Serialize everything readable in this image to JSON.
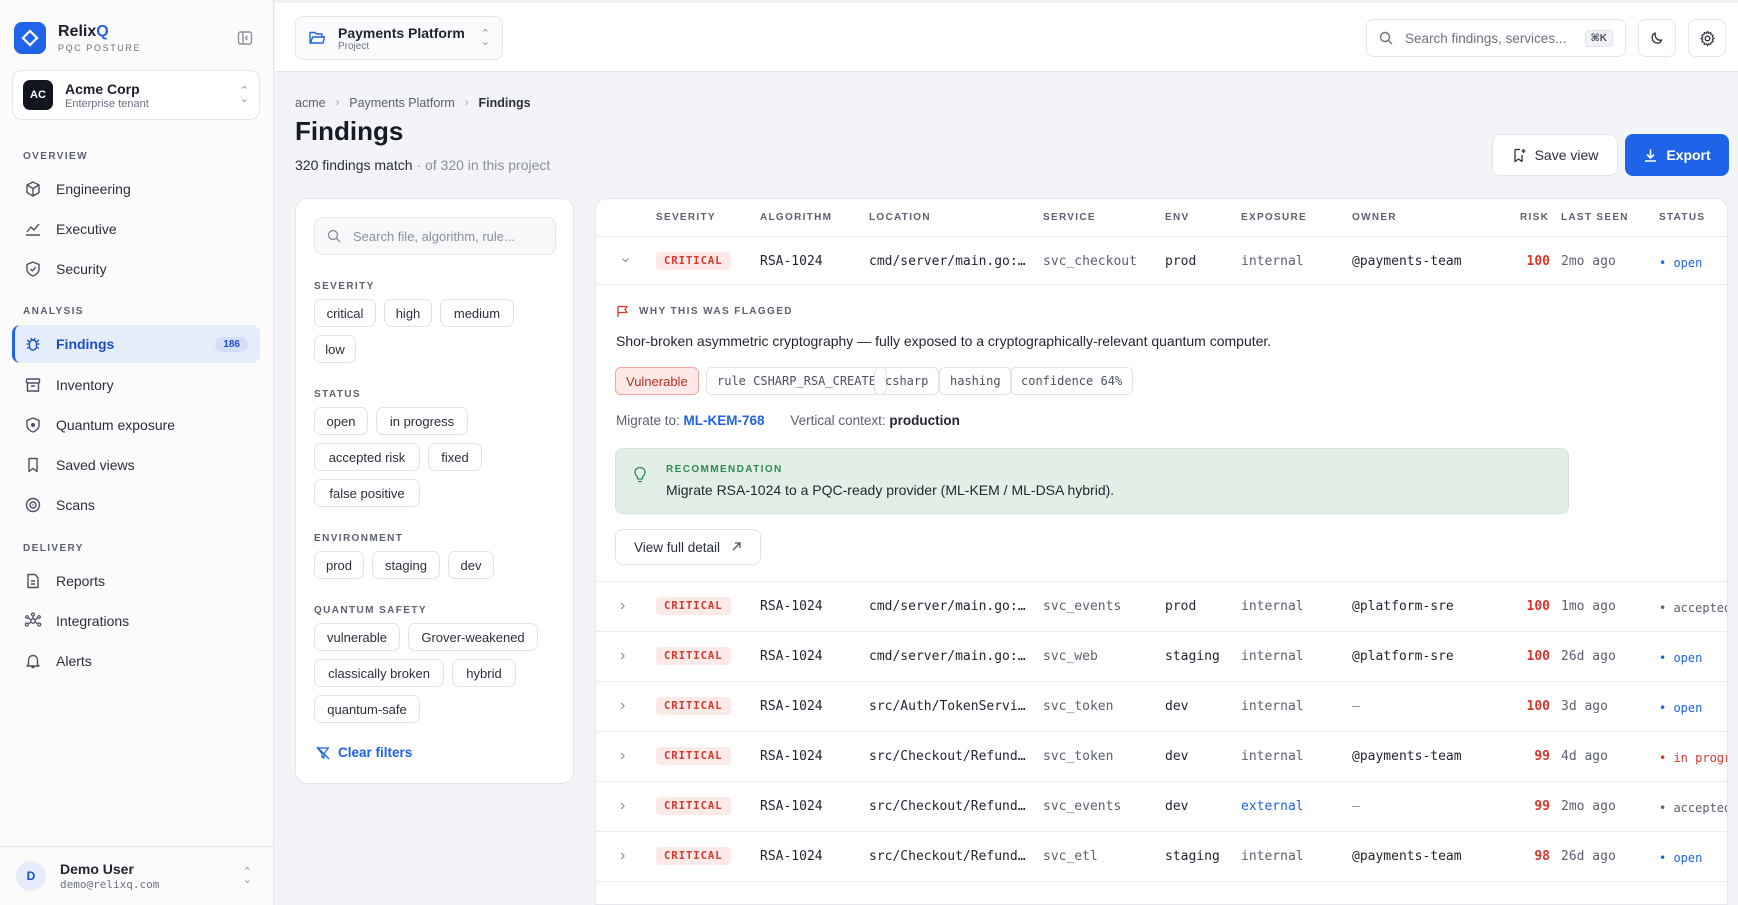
{
  "brand": {
    "name": "Relix",
    "name_q": "Q",
    "sub": "PQC POSTURE"
  },
  "tenant": {
    "initials": "AC",
    "name": "Acme Corp",
    "sub": "Enterprise tenant"
  },
  "nav": {
    "overview_label": "OVERVIEW",
    "analysis_label": "ANALYSIS",
    "delivery_label": "DELIVERY",
    "overview": [
      "Engineering",
      "Executive",
      "Security"
    ],
    "analysis": [
      "Findings",
      "Inventory",
      "Quantum exposure",
      "Saved views",
      "Scans"
    ],
    "findings_badge": "186",
    "delivery": [
      "Reports",
      "Integrations",
      "Alerts"
    ]
  },
  "user": {
    "initial": "D",
    "name": "Demo User",
    "email": "demo@relixq.com"
  },
  "topbar": {
    "project_name": "Payments Platform",
    "project_sub": "Project",
    "search_placeholder": "Search findings, services...",
    "search_kbd": "⌘K"
  },
  "page": {
    "breadcrumb": [
      "acme",
      "Payments Platform",
      "Findings"
    ],
    "title": "Findings",
    "count": "320 findings match",
    "count_sub": " · of 320 in this project",
    "save_view": "Save view",
    "export": "Export"
  },
  "filters": {
    "search_placeholder": "Search file, algorithm, rule...",
    "severity_label": "SEVERITY",
    "severity": [
      "critical",
      "high",
      "medium",
      "low"
    ],
    "status_label": "STATUS",
    "status": [
      "open",
      "in progress",
      "accepted risk",
      "fixed",
      "false positive"
    ],
    "environment_label": "ENVIRONMENT",
    "environment": [
      "prod",
      "staging",
      "dev"
    ],
    "quantum_label": "QUANTUM SAFETY",
    "quantum": [
      "vulnerable",
      "Grover-weakened",
      "classically broken",
      "hybrid",
      "quantum-safe"
    ],
    "clear": "Clear filters"
  },
  "table": {
    "headers": [
      "SEVERITY",
      "ALGORITHM",
      "LOCATION",
      "SERVICE",
      "ENV",
      "EXPOSURE",
      "OWNER",
      "RISK",
      "LAST SEEN",
      "STATUS"
    ],
    "rows": [
      {
        "sev": "CRITICAL",
        "algo": "RSA-1024",
        "loc": "cmd/server/main.go:…",
        "svc": "svc_checkout",
        "env": "prod",
        "exp": "internal",
        "owner": "@payments-team",
        "risk": "100",
        "seen": "2mo ago",
        "status": "• open"
      },
      {
        "sev": "CRITICAL",
        "algo": "RSA-1024",
        "loc": "cmd/server/main.go:…",
        "svc": "svc_events",
        "env": "prod",
        "exp": "internal",
        "owner": "@platform-sre",
        "risk": "100",
        "seen": "1mo ago",
        "status": "• accepted"
      },
      {
        "sev": "CRITICAL",
        "algo": "RSA-1024",
        "loc": "cmd/server/main.go:…",
        "svc": "svc_web",
        "env": "staging",
        "exp": "internal",
        "owner": "@platform-sre",
        "risk": "100",
        "seen": "26d ago",
        "status": "• open"
      },
      {
        "sev": "CRITICAL",
        "algo": "RSA-1024",
        "loc": "src/Auth/TokenServi…",
        "svc": "svc_token",
        "env": "dev",
        "exp": "internal",
        "owner": "–",
        "risk": "100",
        "seen": "3d ago",
        "status": "• open"
      },
      {
        "sev": "CRITICAL",
        "algo": "RSA-1024",
        "loc": "src/Checkout/Refund…",
        "svc": "svc_token",
        "env": "dev",
        "exp": "internal",
        "owner": "@payments-team",
        "risk": "99",
        "seen": "4d ago",
        "status": "• in progr"
      },
      {
        "sev": "CRITICAL",
        "algo": "RSA-1024",
        "loc": "src/Checkout/Refund…",
        "svc": "svc_events",
        "env": "dev",
        "exp": "external",
        "owner": "–",
        "risk": "99",
        "seen": "2mo ago",
        "status": "• accepted"
      },
      {
        "sev": "CRITICAL",
        "algo": "RSA-1024",
        "loc": "src/Checkout/Refund…",
        "svc": "svc_etl",
        "env": "staging",
        "exp": "internal",
        "owner": "@payments-team",
        "risk": "98",
        "seen": "26d ago",
        "status": "• open"
      }
    ]
  },
  "detail": {
    "why_label": "WHY THIS WAS FLAGGED",
    "why_text": "Shor-broken asymmetric cryptography — fully exposed to a cryptographically-relevant quantum computer.",
    "tags": [
      "Vulnerable",
      "rule CSHARP_RSA_CREATE",
      "csharp",
      "hashing",
      "confidence 64%"
    ],
    "migrate_label": "Migrate to:",
    "migrate_to": "ML-KEM-768",
    "vertical_label": "Vertical context:",
    "vertical_value": "production",
    "reco_label": "RECOMMENDATION",
    "reco_text": "Migrate RSA-1024 to a PQC-ready provider (ML-KEM / ML-DSA hybrid).",
    "view_full": "View full detail"
  },
  "colors": {
    "accent": "#1f63e8",
    "critical": "#d9352a",
    "success": "#2e8a54"
  }
}
